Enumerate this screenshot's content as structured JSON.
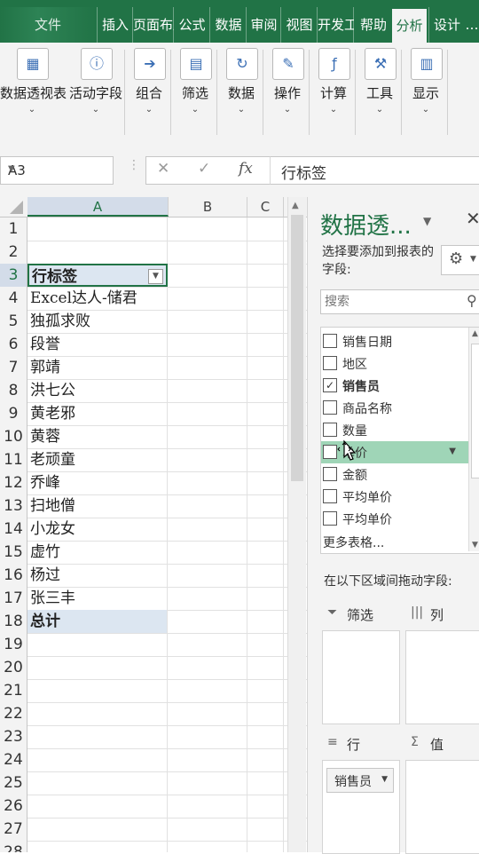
{
  "ribbon_tabs": [
    {
      "label": "文件",
      "active": false
    },
    {
      "label": "插入",
      "active": false
    },
    {
      "label": "页面布局",
      "active": false
    },
    {
      "label": "公式",
      "active": false
    },
    {
      "label": "数据",
      "active": false
    },
    {
      "label": "审阅",
      "active": false
    },
    {
      "label": "视图",
      "active": false
    },
    {
      "label": "开发工具",
      "active": false
    },
    {
      "label": "帮助",
      "active": false
    },
    {
      "label": "分析",
      "active": true
    },
    {
      "label": "设计",
      "active": false
    }
  ],
  "ribbon_groups": [
    {
      "label": "数据透视表",
      "icon": "pivottable-icon"
    },
    {
      "label": "活动字段",
      "icon": "active-field-icon"
    },
    {
      "label": "组合",
      "icon": "group-icon"
    },
    {
      "label": "筛选",
      "icon": "filter-icon"
    },
    {
      "label": "数据",
      "icon": "refresh-data-icon"
    },
    {
      "label": "操作",
      "icon": "actions-icon"
    },
    {
      "label": "计算",
      "icon": "calculations-icon"
    },
    {
      "label": "工具",
      "icon": "tools-icon"
    },
    {
      "label": "显示",
      "icon": "show-icon"
    }
  ],
  "formula_bar": {
    "name_box": "A3",
    "cancel": "✕",
    "confirm": "✓",
    "fx": "fx",
    "value": "行标签"
  },
  "grid": {
    "columns": [
      "A",
      "B",
      "C"
    ],
    "selected_column": "A",
    "rows": [
      {
        "n": "1",
        "a": ""
      },
      {
        "n": "2",
        "a": ""
      },
      {
        "n": "3",
        "a": "行标签",
        "style": "hdr"
      },
      {
        "n": "4",
        "a": "Excel达人-储君"
      },
      {
        "n": "5",
        "a": "独孤求败"
      },
      {
        "n": "6",
        "a": "段誉"
      },
      {
        "n": "7",
        "a": "郭靖"
      },
      {
        "n": "8",
        "a": "洪七公"
      },
      {
        "n": "9",
        "a": "黄老邪"
      },
      {
        "n": "10",
        "a": "黄蓉"
      },
      {
        "n": "11",
        "a": "老顽童"
      },
      {
        "n": "12",
        "a": "乔峰"
      },
      {
        "n": "13",
        "a": "扫地僧"
      },
      {
        "n": "14",
        "a": "小龙女"
      },
      {
        "n": "15",
        "a": "虚竹"
      },
      {
        "n": "16",
        "a": "杨过"
      },
      {
        "n": "17",
        "a": "张三丰"
      },
      {
        "n": "18",
        "a": "总计",
        "style": "tot"
      },
      {
        "n": "19",
        "a": ""
      },
      {
        "n": "20",
        "a": ""
      },
      {
        "n": "21",
        "a": ""
      },
      {
        "n": "22",
        "a": ""
      },
      {
        "n": "23",
        "a": ""
      },
      {
        "n": "24",
        "a": ""
      },
      {
        "n": "25",
        "a": ""
      },
      {
        "n": "26",
        "a": ""
      },
      {
        "n": "27",
        "a": ""
      },
      {
        "n": "28",
        "a": ""
      }
    ]
  },
  "pivot_pane": {
    "title": "数据透...",
    "subtitle": "选择要添加到报表的字段:",
    "search_placeholder": "搜索",
    "fields": [
      {
        "label": "销售日期",
        "checked": false
      },
      {
        "label": "地区",
        "checked": false
      },
      {
        "label": "销售员",
        "checked": true
      },
      {
        "label": "商品名称",
        "checked": false
      },
      {
        "label": "数量",
        "checked": false
      },
      {
        "label": "单价",
        "checked": false,
        "highlighted": true
      },
      {
        "label": "金额",
        "checked": false
      },
      {
        "label": "平均单价",
        "checked": false
      },
      {
        "label": "平均单价",
        "checked": false
      }
    ],
    "more_tables": "更多表格...",
    "drag_hint": "在以下区域间拖动字段:",
    "areas": {
      "filters": "筛选",
      "columns": "列",
      "rows": "行",
      "values": "值"
    },
    "row_chip": "销售员"
  },
  "colors": {
    "excel_green": "#217346",
    "header_fill": "#dce6f1",
    "drag_highlight": "#9fd5b7"
  }
}
